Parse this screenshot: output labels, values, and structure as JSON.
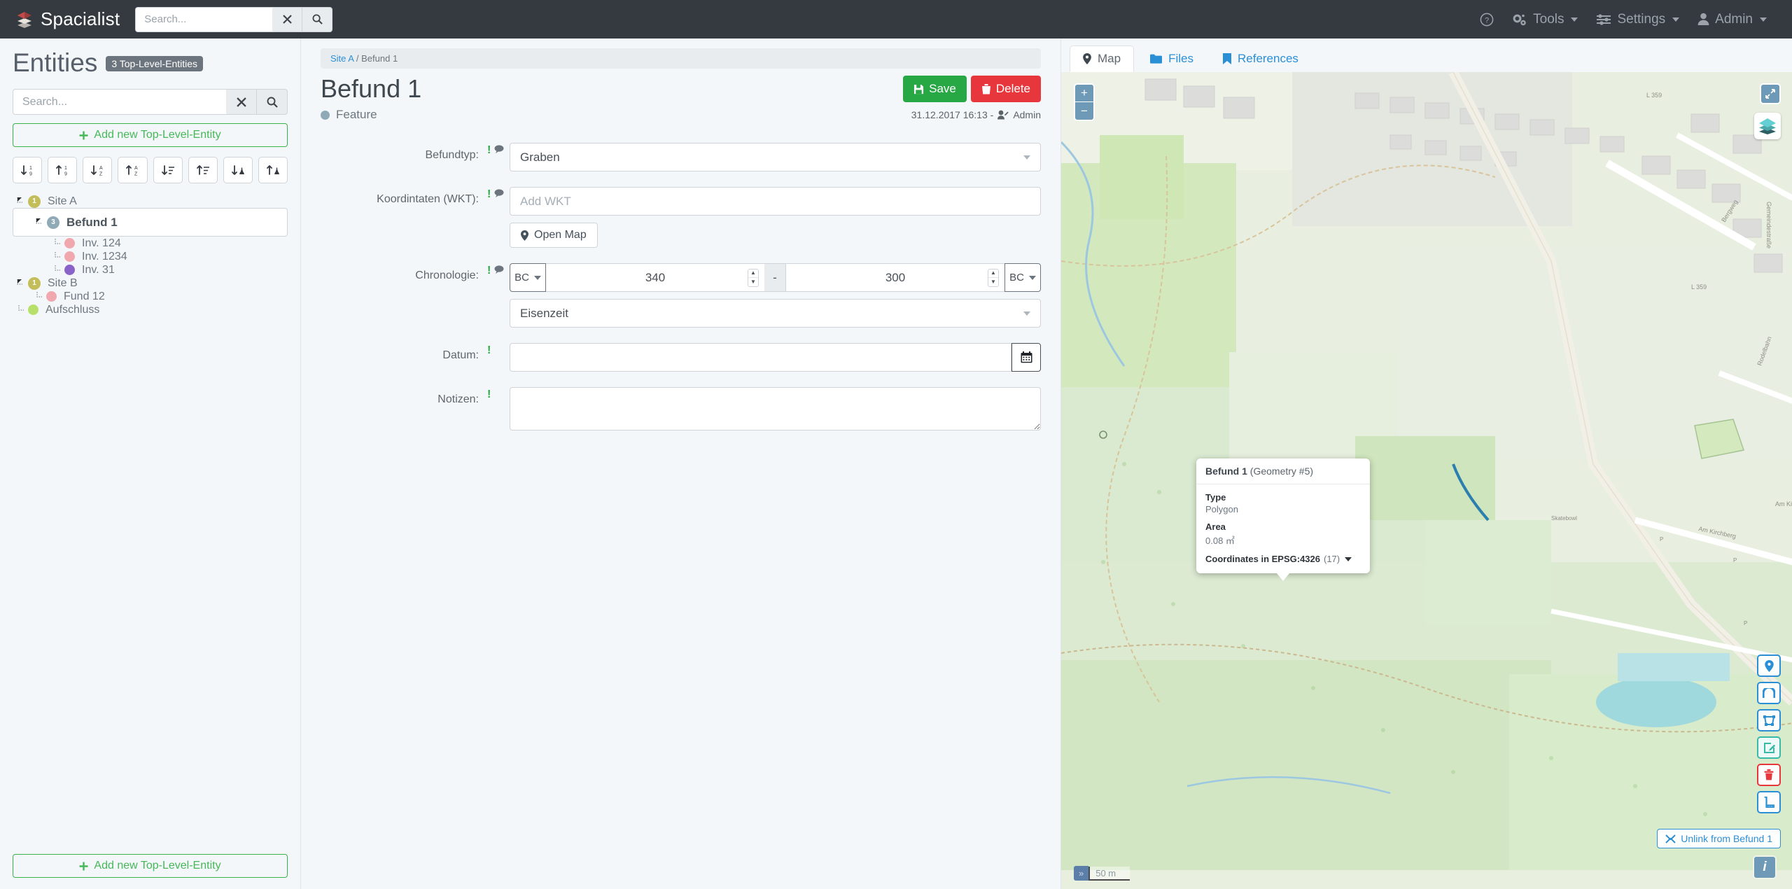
{
  "navbar": {
    "brand": "Spacialist",
    "search_placeholder": "Search...",
    "search_value": "",
    "clear_label": "✕",
    "help_label": "",
    "items": [
      {
        "label": "Tools",
        "icon": "gears-icon"
      },
      {
        "label": "Settings",
        "icon": "sliders-icon"
      },
      {
        "label": "Admin",
        "icon": "user-icon"
      }
    ]
  },
  "sidebar": {
    "title": "Entities",
    "badge": "3 Top-Level-Entities",
    "search_placeholder": "Search...",
    "search_value": "",
    "add_label": "Add new Top-Level-Entity",
    "add_bottom_label": "Add new Top-Level-Entity",
    "sort_buttons": [
      {
        "name": "sort-numeric-down",
        "icon": "arrow-down-1-9"
      },
      {
        "name": "sort-numeric-up",
        "icon": "arrow-up-1-9"
      },
      {
        "name": "sort-alpha-down",
        "icon": "arrow-down-a-z"
      },
      {
        "name": "sort-alpha-up",
        "icon": "arrow-up-a-z"
      },
      {
        "name": "sort-amount-down",
        "icon": "arrow-down-wide-short"
      },
      {
        "name": "sort-amount-up",
        "icon": "arrow-up-wide-short"
      },
      {
        "name": "sort-type-down",
        "icon": "arrow-down-monument"
      },
      {
        "name": "sort-type-up",
        "icon": "arrow-up-monument"
      }
    ],
    "tree": [
      {
        "label": "Site A",
        "depth": 0,
        "marker": "count",
        "count": "1",
        "color": "#c3bd5a",
        "selected": false,
        "expander": "open"
      },
      {
        "label": "Befund 1",
        "depth": 1,
        "marker": "count",
        "count": "3",
        "color": "#8fa9b6",
        "selected": true,
        "expander": "open"
      },
      {
        "label": "Inv. 124",
        "depth": 2,
        "marker": "dot",
        "count": "",
        "color": "#f0a8ae",
        "selected": false,
        "expander": "leaf"
      },
      {
        "label": "Inv. 1234",
        "depth": 2,
        "marker": "dot",
        "count": "",
        "color": "#f0a8ae",
        "selected": false,
        "expander": "leaf"
      },
      {
        "label": "Inv. 31",
        "depth": 2,
        "marker": "dot",
        "count": "",
        "color": "#8a63c9",
        "selected": false,
        "expander": "leaf"
      },
      {
        "label": "Site B",
        "depth": 0,
        "marker": "count",
        "count": "1",
        "color": "#c3bd5a",
        "selected": false,
        "expander": "open"
      },
      {
        "label": "Fund 12",
        "depth": 1,
        "marker": "dot",
        "count": "",
        "color": "#f0a8ae",
        "selected": false,
        "expander": "leaf"
      },
      {
        "label": "Aufschluss",
        "depth": 0,
        "marker": "dot",
        "count": "",
        "color": "#b6e06a",
        "selected": false,
        "expander": "leaf"
      }
    ]
  },
  "detail": {
    "breadcrumb_parent": "Site A",
    "breadcrumb_sep": "/",
    "breadcrumb_current": "Befund 1",
    "title": "Befund 1",
    "save_label": "Save",
    "delete_label": "Delete",
    "type_label": "Feature",
    "timestamp": "31.12.2017 16:13 -",
    "user": "Admin",
    "fields": {
      "befundtyp_label": "Befundtyp:",
      "befundtyp_value": "Graben",
      "wkt_label": "Koordintaten (WKT):",
      "wkt_placeholder": "Add WKT",
      "wkt_value": "",
      "open_map_label": "Open Map",
      "chronologie_label": "Chronologie:",
      "chrono_from_era": "BC",
      "chrono_from": "340",
      "chrono_separator": "-",
      "chrono_to": "300",
      "chrono_to_era": "BC",
      "chrono_period": "Eisenzeit",
      "datum_label": "Datum:",
      "datum_value": "",
      "notizen_label": "Notizen:",
      "notizen_value": ""
    }
  },
  "map": {
    "tabs": [
      {
        "label": "Map",
        "icon": "map-pin-icon",
        "active": true
      },
      {
        "label": "Files",
        "icon": "folder-icon",
        "active": false
      },
      {
        "label": "References",
        "icon": "bookmark-icon",
        "active": false
      }
    ],
    "zoom_in": "+",
    "zoom_out": "−",
    "scale_label": "50 m",
    "attribution_toggle": "»",
    "info_label": "i",
    "unlink_label": "Unlink from Befund 1",
    "draw_tools": [
      {
        "name": "draw-marker-tool",
        "icon": "map-marker-icon",
        "state": "normal"
      },
      {
        "name": "draw-line-tool",
        "icon": "polyline-icon",
        "state": "normal"
      },
      {
        "name": "draw-polygon-tool",
        "icon": "polygon-icon",
        "state": "normal"
      },
      {
        "name": "edit-geometry-tool",
        "icon": "pencil-square-icon",
        "state": "active"
      },
      {
        "name": "delete-geometry-tool",
        "icon": "trash-icon",
        "state": "danger"
      },
      {
        "name": "measure-tool",
        "icon": "ruler-icon",
        "state": "normal"
      }
    ],
    "popup": {
      "title_main": "Befund 1",
      "title_sub": "(Geometry #5)",
      "type_key": "Type",
      "type_value": "Polygon",
      "area_key": "Area",
      "area_value": "0.08 ㎡",
      "coords_key": "Coordinates in EPSG:4326",
      "coords_count": "(17)"
    },
    "labels": [
      "L 359",
      "L 359",
      "Am Kirchberg",
      "Gemeindestraße",
      "Bergweg",
      "Rodelbahn",
      "Am Ki",
      "P",
      "P",
      "P"
    ]
  },
  "colors": {
    "navbar_bg": "#343a40",
    "accent_blue": "#2b8fd6",
    "success": "#28a745",
    "danger": "#e8373c",
    "map_green": "#cfe3b4",
    "map_light": "#e8efdf"
  }
}
